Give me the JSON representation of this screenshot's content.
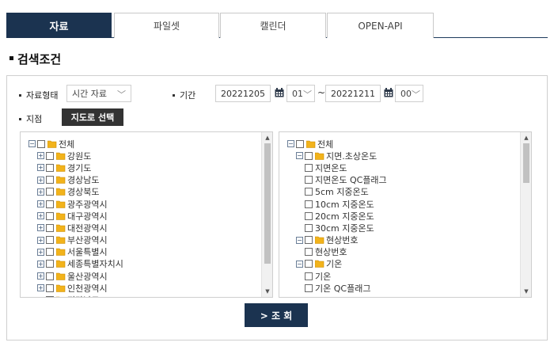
{
  "tabs": [
    {
      "label": "자료"
    },
    {
      "label": "파일셋"
    },
    {
      "label": "캘린더"
    },
    {
      "label": "OPEN-API"
    }
  ],
  "section_title": "검색조건",
  "form": {
    "data_type_label": "자료형태",
    "data_type_value": "시간 자료",
    "period_label": "기간",
    "start_date": "20221205",
    "start_hour": "01",
    "tilde": "~",
    "end_date": "20221211",
    "end_hour": "00",
    "station_label": "지점",
    "map_select_label": "지도로 선택"
  },
  "left_tree": [
    {
      "label": "전체",
      "level": 0,
      "exp": "−"
    },
    {
      "label": "강원도",
      "level": 1,
      "exp": "+"
    },
    {
      "label": "경기도",
      "level": 1,
      "exp": "+"
    },
    {
      "label": "경상남도",
      "level": 1,
      "exp": "+"
    },
    {
      "label": "경상북도",
      "level": 1,
      "exp": "+"
    },
    {
      "label": "광주광역시",
      "level": 1,
      "exp": "+"
    },
    {
      "label": "대구광역시",
      "level": 1,
      "exp": "+"
    },
    {
      "label": "대전광역시",
      "level": 1,
      "exp": "+"
    },
    {
      "label": "부산광역시",
      "level": 1,
      "exp": "+"
    },
    {
      "label": "서울특별시",
      "level": 1,
      "exp": "+"
    },
    {
      "label": "세종특별자치시",
      "level": 1,
      "exp": "+"
    },
    {
      "label": "울산광역시",
      "level": 1,
      "exp": "+"
    },
    {
      "label": "인천광역시",
      "level": 1,
      "exp": "+"
    },
    {
      "label": "전라남도",
      "level": 1,
      "exp": "+"
    }
  ],
  "right_tree": [
    {
      "label": "전체",
      "level": 0,
      "exp": "−",
      "folder": true
    },
    {
      "label": "지면.초상온도",
      "level": 1,
      "exp": "−",
      "folder": true
    },
    {
      "label": "지면온도",
      "level": 2,
      "exp": "",
      "folder": false
    },
    {
      "label": "지면온도 QC플래그",
      "level": 2,
      "exp": "",
      "folder": false
    },
    {
      "label": "5cm 지중온도",
      "level": 2,
      "exp": "",
      "folder": false
    },
    {
      "label": "10cm 지중온도",
      "level": 2,
      "exp": "",
      "folder": false
    },
    {
      "label": "20cm 지중온도",
      "level": 2,
      "exp": "",
      "folder": false
    },
    {
      "label": "30cm 지중온도",
      "level": 2,
      "exp": "",
      "folder": false
    },
    {
      "label": "현상번호",
      "level": 1,
      "exp": "−",
      "folder": true
    },
    {
      "label": "현상번호",
      "level": 2,
      "exp": "",
      "folder": false
    },
    {
      "label": "기온",
      "level": 1,
      "exp": "−",
      "folder": true
    },
    {
      "label": "기온",
      "level": 2,
      "exp": "",
      "folder": false
    },
    {
      "label": "기온 QC플래그",
      "level": 2,
      "exp": "",
      "folder": false
    }
  ],
  "search_button": "> 조 회",
  "colors": {
    "navy": "#1b3350",
    "folder": "#f2b31b",
    "dark_button": "#333333"
  }
}
